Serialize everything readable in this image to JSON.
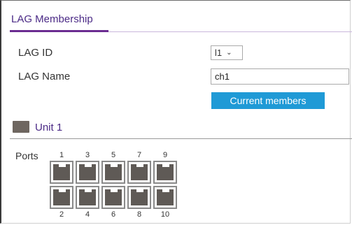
{
  "section": {
    "title": "LAG Membership"
  },
  "form": {
    "lag_id_label": "LAG ID",
    "lag_id_value": "l1",
    "lag_name_label": "LAG Name",
    "lag_name_value": "ch1",
    "current_members_button": "Current members"
  },
  "unit": {
    "label": "Unit 1"
  },
  "ports": {
    "label": "Ports",
    "top_numbers": [
      "1",
      "3",
      "5",
      "7",
      "9"
    ],
    "bottom_numbers": [
      "2",
      "4",
      "6",
      "8",
      "10"
    ]
  }
}
